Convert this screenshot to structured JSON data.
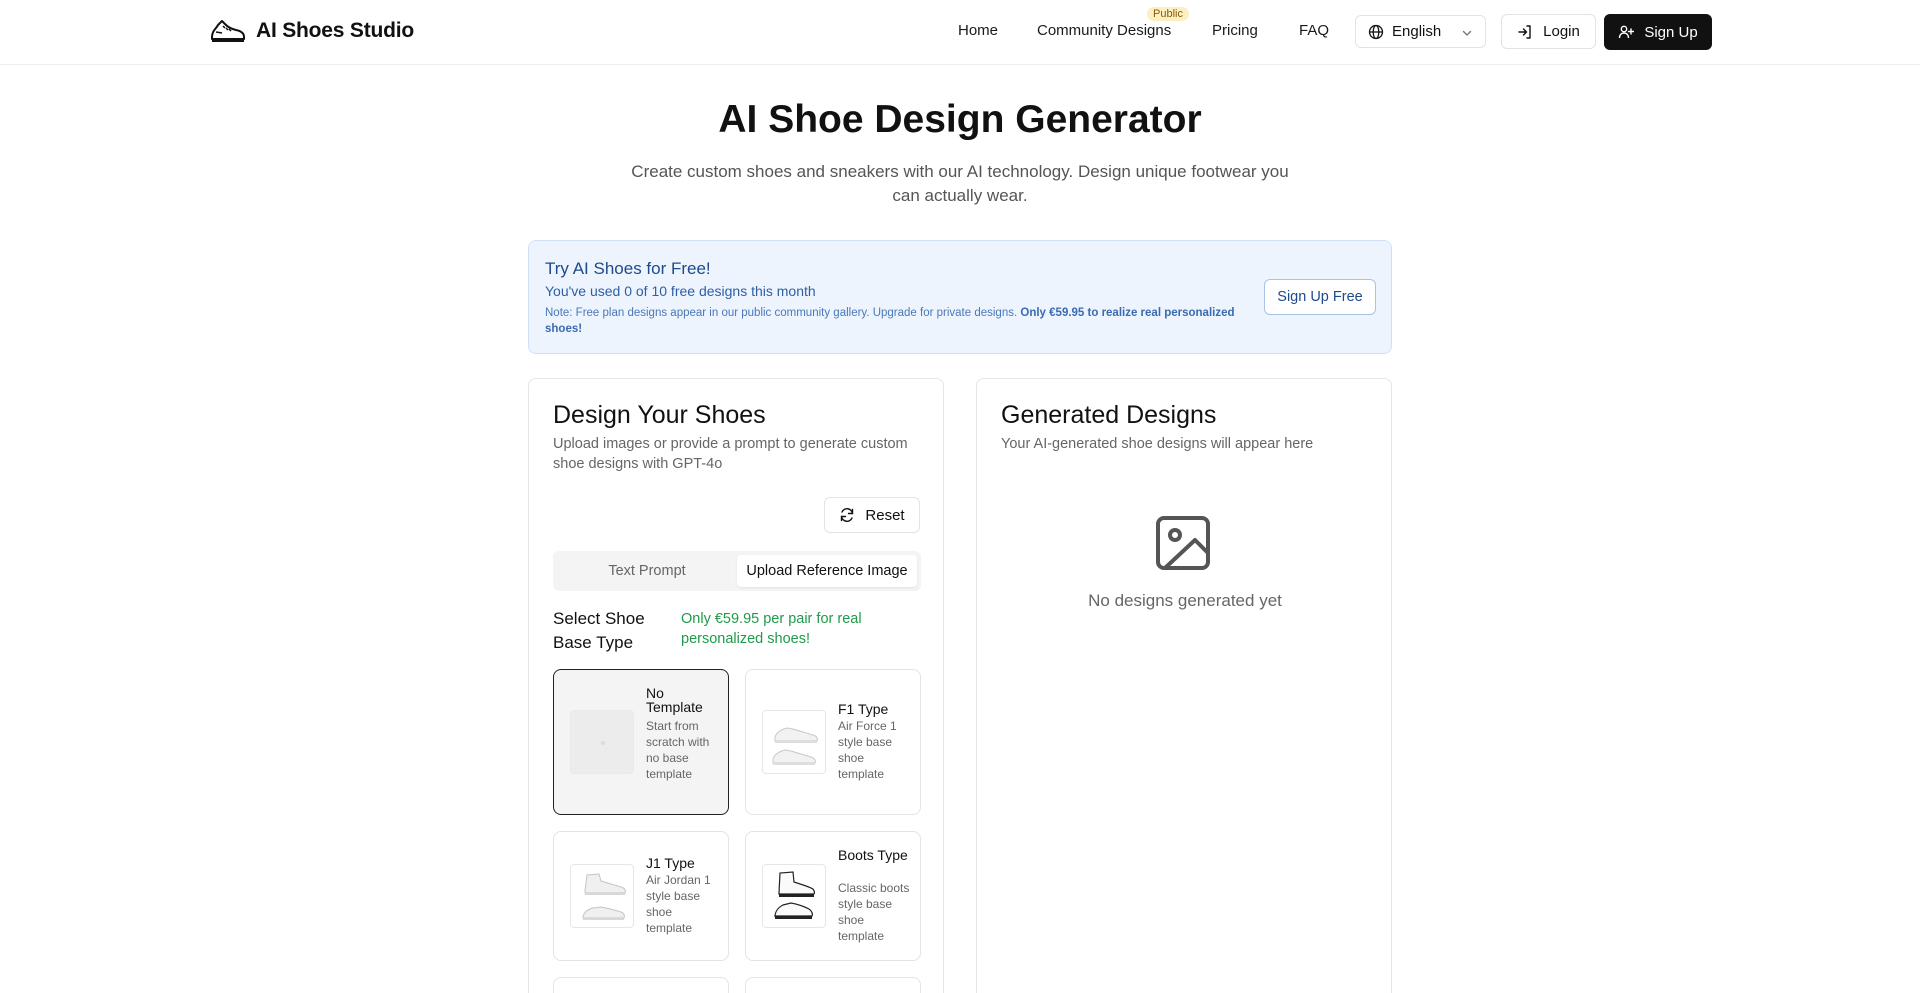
{
  "brand": {
    "name": "AI Shoes Studio",
    "logo_icon": "sneaker-logo-icon"
  },
  "nav": {
    "home": "Home",
    "community": "Community Designs",
    "community_badge": "Public",
    "pricing": "Pricing",
    "faq": "FAQ",
    "language": "English",
    "login": "Login",
    "signup": "Sign Up"
  },
  "hero": {
    "title": "AI Shoe Design Generator",
    "subtitle": "Create custom shoes and sneakers with our AI technology. Design unique footwear you can actually wear."
  },
  "banner": {
    "title": "Try AI Shoes for Free!",
    "used": "You've used 0 of 10 free designs this month",
    "note": "Note: Free plan designs appear in our public community gallery. Upgrade for private designs.",
    "note_bold": "Only €59.95 to realize real personalized shoes!",
    "button": "Sign Up Free"
  },
  "design_card": {
    "title": "Design Your Shoes",
    "description": "Upload images or provide a prompt to generate custom shoe designs with GPT-4o",
    "reset": "Reset",
    "tabs": {
      "text": "Text Prompt",
      "upload": "Upload Reference Image",
      "active": "upload"
    },
    "select_label": "Select Shoe Base Type",
    "promo": "Only €59.95 per pair for real personalized shoes!",
    "templates": [
      {
        "name": "No Template",
        "desc": "Start from scratch with no base template",
        "selected": true
      },
      {
        "name": "F1 Type",
        "desc": "Air Force 1 style base shoe template",
        "selected": false
      },
      {
        "name": "J1 Type",
        "desc": "Air Jordan 1 style base shoe template",
        "selected": false
      },
      {
        "name": "Boots Type",
        "desc": "Classic boots style base shoe template",
        "selected": false
      }
    ]
  },
  "generated_card": {
    "title": "Generated Designs",
    "description": "Your AI-generated shoe designs will appear here",
    "empty": "No designs generated yet",
    "empty_icon": "image-placeholder-icon"
  },
  "colors": {
    "primary": "#111111",
    "banner_bg": "#eef4fd",
    "banner_text": "#1d4a8a",
    "promo_green": "#1f9a4b",
    "badge_bg": "#fdefc4"
  }
}
